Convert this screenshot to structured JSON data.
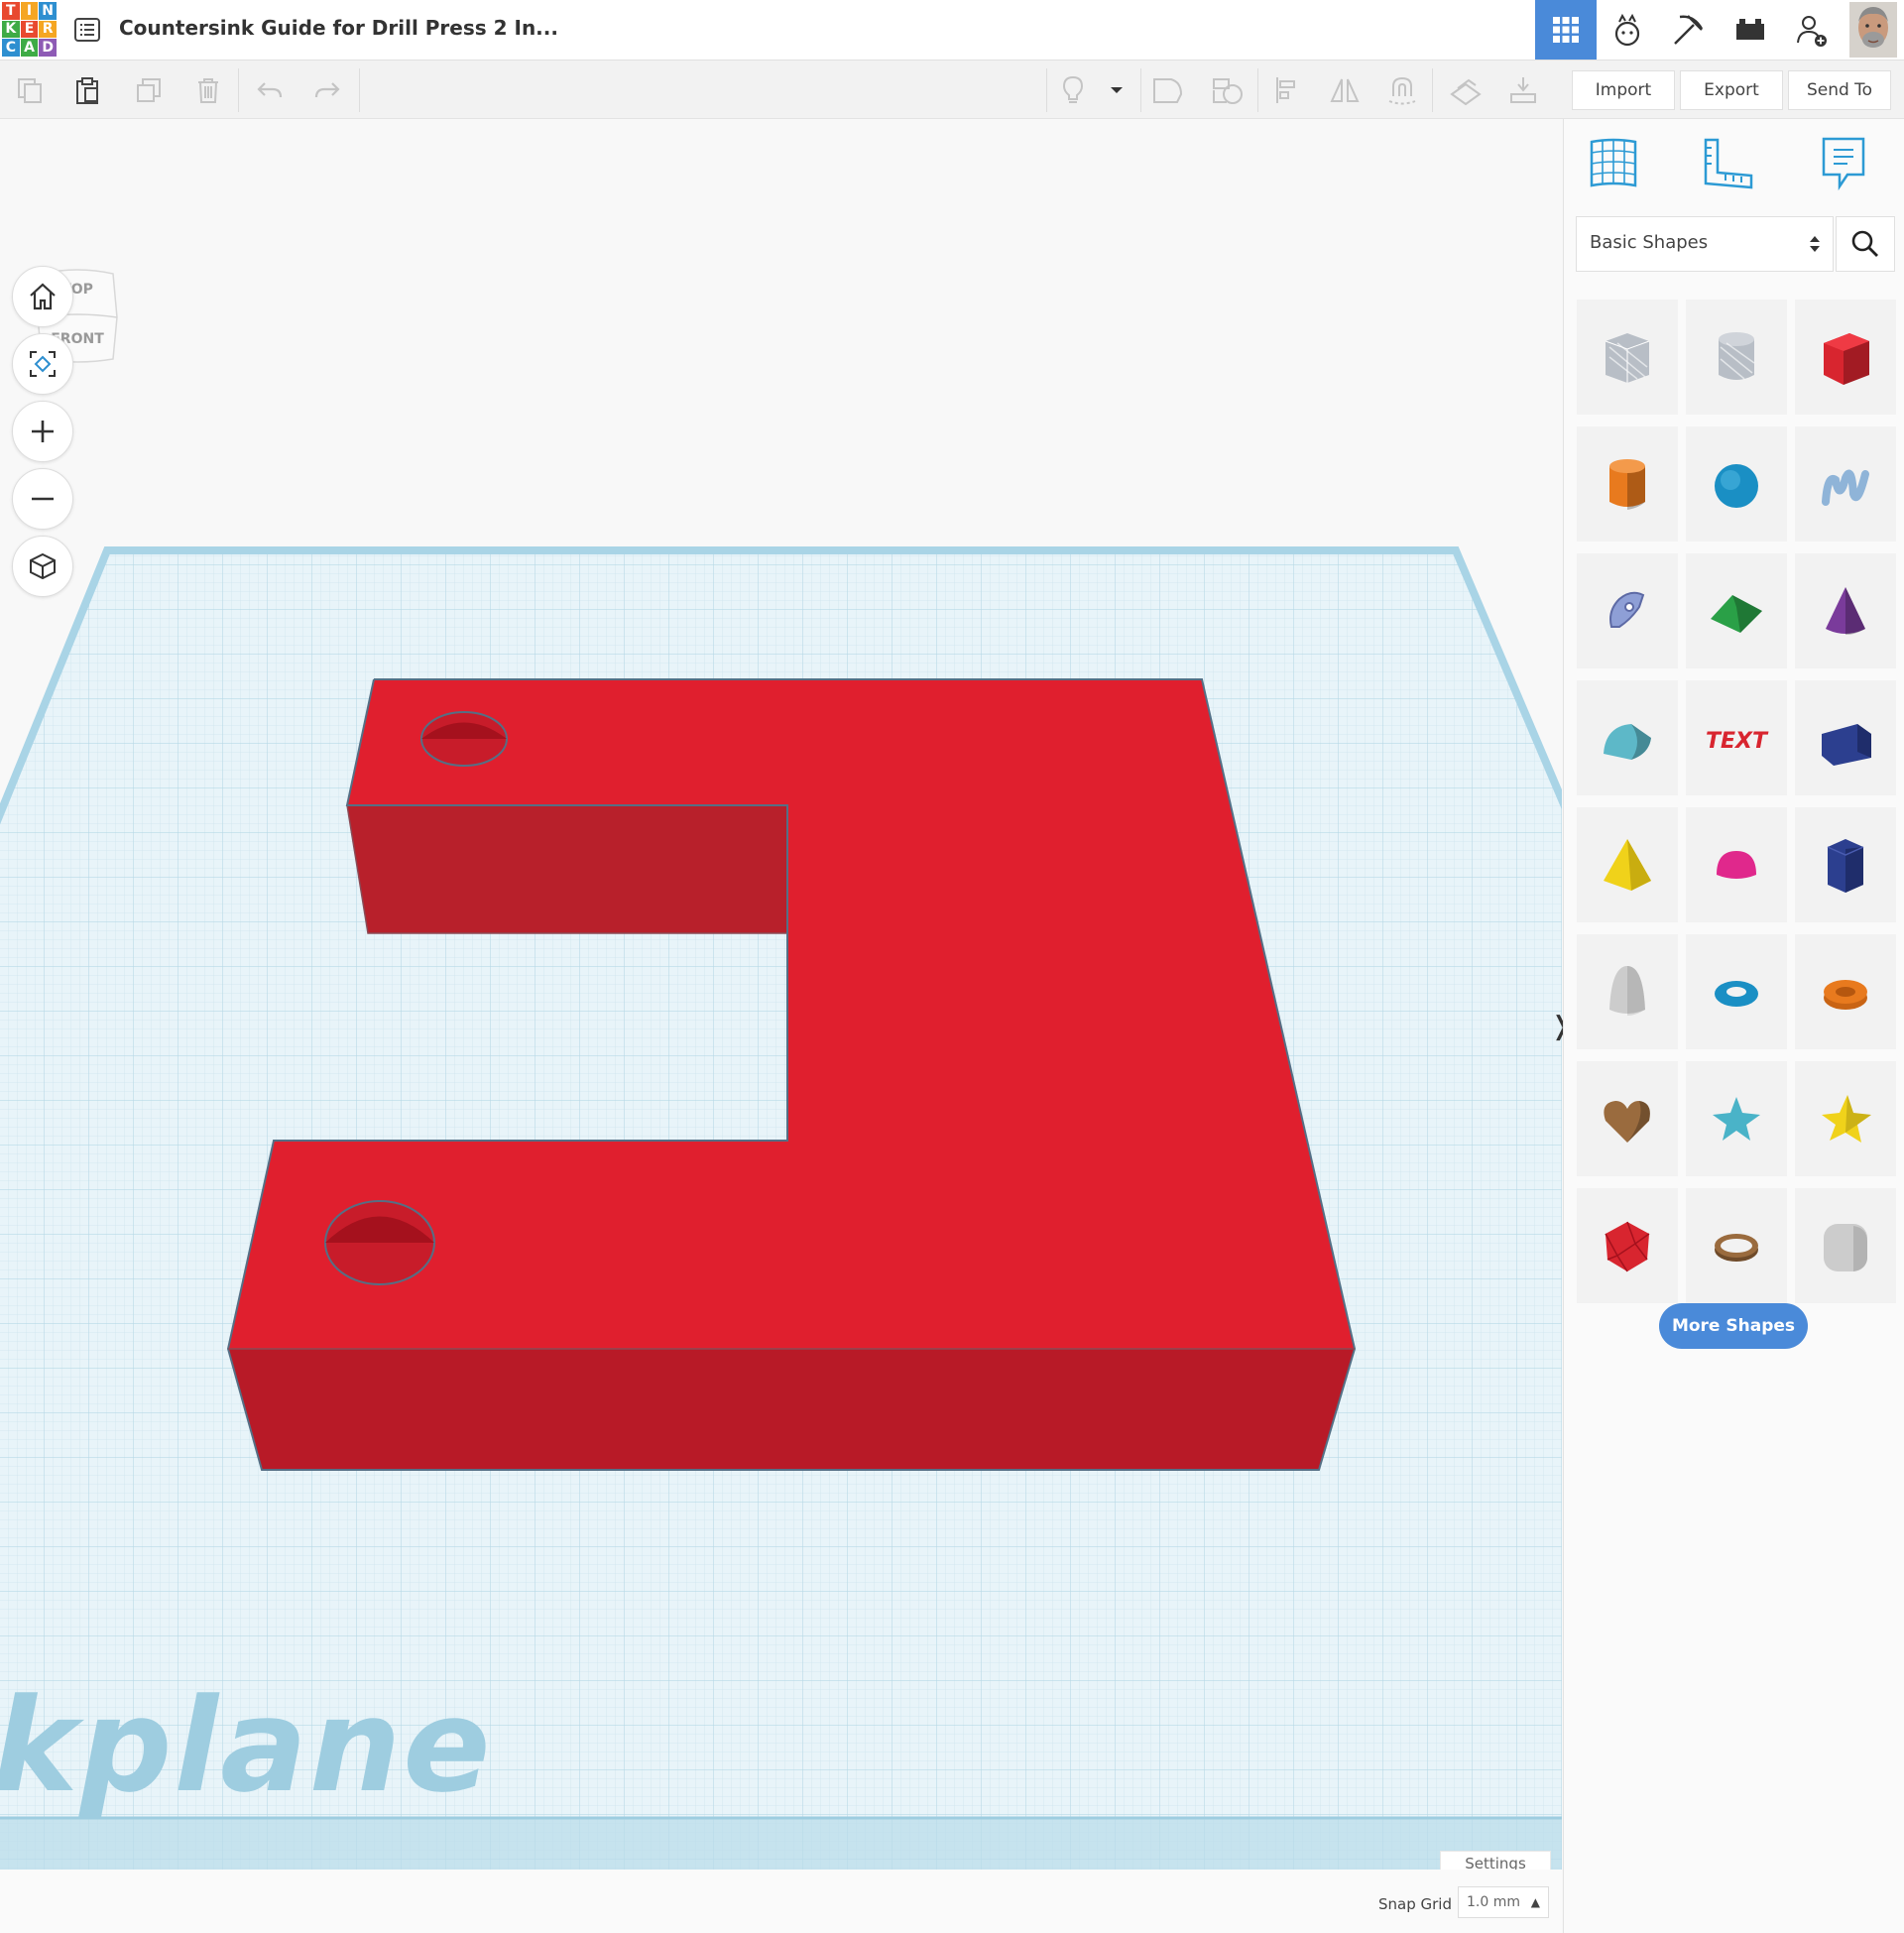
{
  "app": {
    "logo_letters": [
      "T",
      "I",
      "N",
      "K",
      "E",
      "R",
      "C",
      "A",
      "D"
    ],
    "logo_colors": [
      "#e8492f",
      "#f5a623",
      "#2e8fd0",
      "#3eab46",
      "#e8492f",
      "#f5a623",
      "#2e8fd0",
      "#3eab46",
      "#8e5bb5"
    ],
    "document_title": "Countersink Guide for Drill Press 2 In..."
  },
  "top_icons": [
    "grid-view-icon",
    "bonus-icon",
    "minecraft-icon",
    "bricks-icon",
    "add-user-icon",
    "avatar"
  ],
  "toolbar": {
    "import_label": "Import",
    "export_label": "Export",
    "send_to_label": "Send To"
  },
  "view_cube": {
    "top_label": "TOP",
    "front_label": "FRONT"
  },
  "workplane_label": "kplane",
  "panel": {
    "category": "Basic Shapes",
    "shapes": [
      {
        "name": "box-hole",
        "color": "#b8bec6"
      },
      {
        "name": "cylinder-hole",
        "color": "#b8bec6"
      },
      {
        "name": "box",
        "color": "#d8252f"
      },
      {
        "name": "cylinder",
        "color": "#e87a1e"
      },
      {
        "name": "sphere",
        "color": "#1a8fc4"
      },
      {
        "name": "scribble",
        "color": "#8fb4d8"
      },
      {
        "name": "shape-generator",
        "color": "#8e9fd6"
      },
      {
        "name": "roof",
        "color": "#2aa047"
      },
      {
        "name": "cone",
        "color": "#7a3b9b"
      },
      {
        "name": "round-roof",
        "color": "#5db8c8"
      },
      {
        "name": "text",
        "color": "#d8252f"
      },
      {
        "name": "wedge",
        "color": "#2c3f8f"
      },
      {
        "name": "pyramid",
        "color": "#f0d21a"
      },
      {
        "name": "half-sphere",
        "color": "#e0288c"
      },
      {
        "name": "polygon",
        "color": "#2c3f8f"
      },
      {
        "name": "paraboloid",
        "color": "#cccccc"
      },
      {
        "name": "torus",
        "color": "#1a8fc4"
      },
      {
        "name": "tube",
        "color": "#e87a1e"
      },
      {
        "name": "heart",
        "color": "#9a6b3e"
      },
      {
        "name": "star-six",
        "color": "#4ab3c8"
      },
      {
        "name": "star",
        "color": "#f0d21a"
      },
      {
        "name": "icosahedron",
        "color": "#d8252f"
      },
      {
        "name": "ring",
        "color": "#9a6b3e"
      },
      {
        "name": "rounded-box",
        "color": "#cccccc"
      }
    ],
    "more_shapes_label": "More Shapes"
  },
  "settings_label": "Settings",
  "snap_grid": {
    "label": "Snap Grid",
    "value": "1.0 mm"
  }
}
